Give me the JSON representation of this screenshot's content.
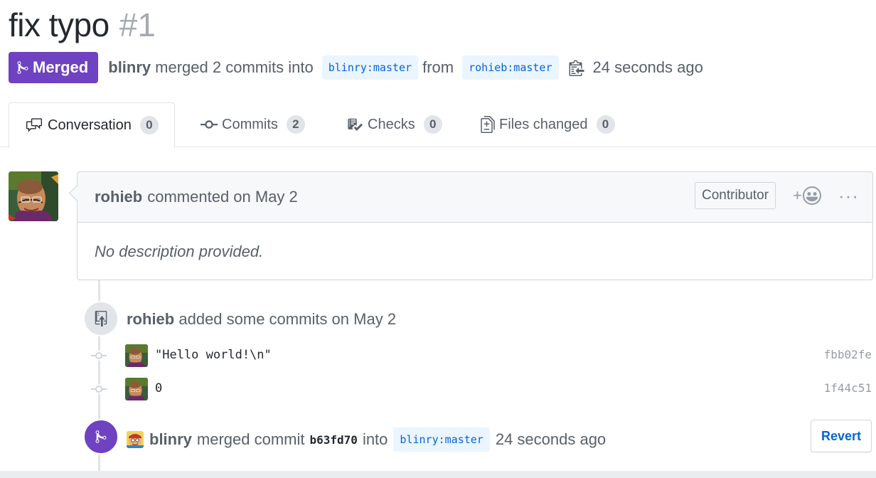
{
  "header": {
    "title": "fix typo",
    "number": "#1",
    "state_label": "Merged",
    "merger": "blinry",
    "merged_text": "merged 2 commits into",
    "base_branch": "blinry:master",
    "from_text": "from",
    "head_branch": "rohieb:master",
    "time": "24 seconds ago"
  },
  "tabs": [
    {
      "label": "Conversation",
      "count": "0",
      "icon": "comment-discussion-icon"
    },
    {
      "label": "Commits",
      "count": "2",
      "icon": "git-commit-icon"
    },
    {
      "label": "Checks",
      "count": "0",
      "icon": "checklist-icon"
    },
    {
      "label": "Files changed",
      "count": "0",
      "icon": "diff-icon"
    }
  ],
  "comment": {
    "author": "rohieb",
    "action": "commented on May 2",
    "role": "Contributor",
    "reaction_plus": "+",
    "more": "···",
    "body": "No description provided."
  },
  "commits_event": {
    "author": "rohieb",
    "text": "added some commits on May 2"
  },
  "commits": [
    {
      "message": "\"Hello world!\\n\"",
      "sha": "fbb02fe"
    },
    {
      "message": "0",
      "sha": "1f44c51"
    }
  ],
  "merge_event": {
    "author": "blinry",
    "text1": "merged commit",
    "sha": "b63fd70",
    "text2": "into",
    "branch": "blinry:master",
    "time": "24 seconds ago",
    "revert_label": "Revert"
  },
  "colors": {
    "merged": "#6f42c1",
    "link": "#0366d6",
    "branch_bg": "#eaf5ff",
    "muted": "#586069"
  }
}
